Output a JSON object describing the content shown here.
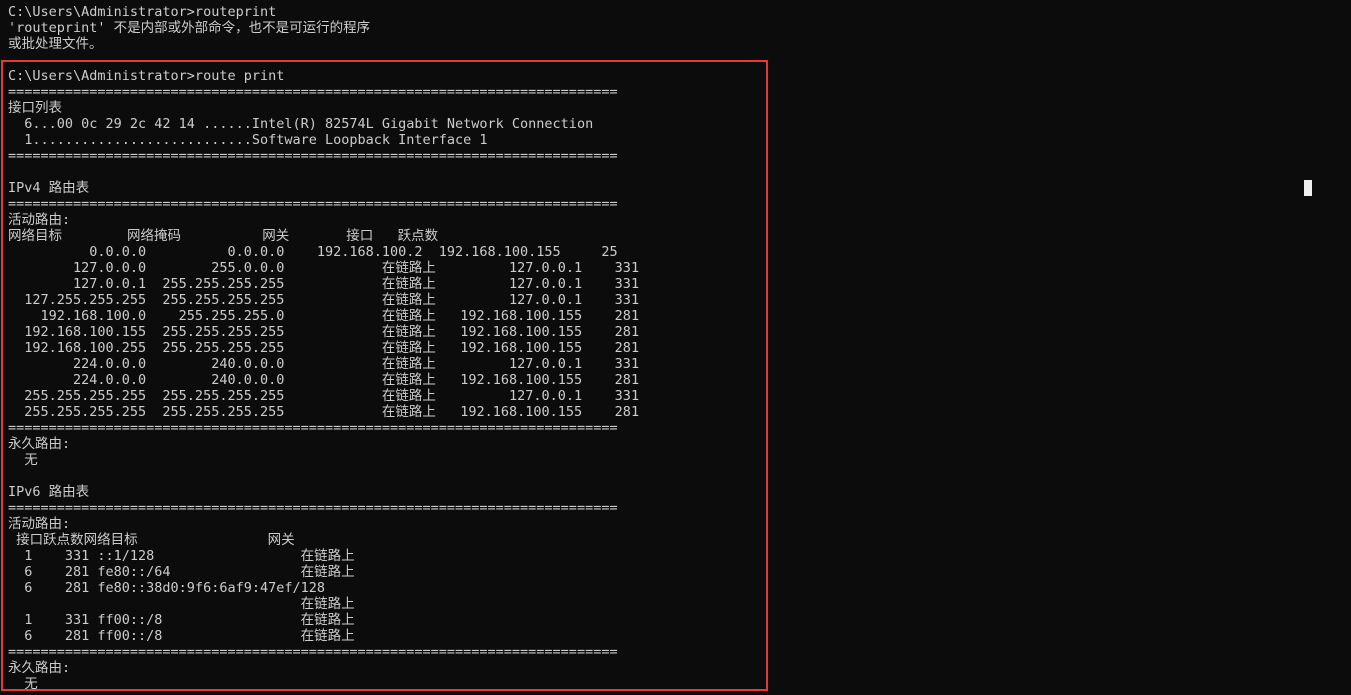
{
  "console": {
    "lines": [
      "C:\\Users\\Administrator>routeprint",
      "'routeprint' 不是内部或外部命令，也不是可运行的程序",
      "或批处理文件。",
      "",
      "C:\\Users\\Administrator>route print",
      "===========================================================================",
      "接口列表",
      "  6...00 0c 29 2c 42 14 ......Intel(R) 82574L Gigabit Network Connection",
      "  1...........................Software Loopback Interface 1",
      "===========================================================================",
      "",
      "IPv4 路由表",
      "===========================================================================",
      "活动路由:",
      "网络目标        网络掩码          网关       接口   跃点数",
      "          0.0.0.0          0.0.0.0    192.168.100.2  192.168.100.155     25",
      "        127.0.0.0        255.0.0.0            在链路上         127.0.0.1    331",
      "        127.0.0.1  255.255.255.255            在链路上         127.0.0.1    331",
      "  127.255.255.255  255.255.255.255            在链路上         127.0.0.1    331",
      "    192.168.100.0    255.255.255.0            在链路上   192.168.100.155    281",
      "  192.168.100.155  255.255.255.255            在链路上   192.168.100.155    281",
      "  192.168.100.255  255.255.255.255            在链路上   192.168.100.155    281",
      "        224.0.0.0        240.0.0.0            在链路上         127.0.0.1    331",
      "        224.0.0.0        240.0.0.0            在链路上   192.168.100.155    281",
      "  255.255.255.255  255.255.255.255            在链路上         127.0.0.1    331",
      "  255.255.255.255  255.255.255.255            在链路上   192.168.100.155    281",
      "===========================================================================",
      "永久路由:",
      "  无",
      "",
      "IPv6 路由表",
      "===========================================================================",
      "活动路由:",
      " 接口跃点数网络目标                网关",
      "  1    331 ::1/128                  在链路上",
      "  6    281 fe80::/64                在链路上",
      "  6    281 fe80::38d0:9f6:6af9:47ef/128",
      "                                    在链路上",
      "  1    331 ff00::/8                 在链路上",
      "  6    281 ff00::/8                 在链路上",
      "===========================================================================",
      "永久路由:",
      "  无"
    ]
  }
}
